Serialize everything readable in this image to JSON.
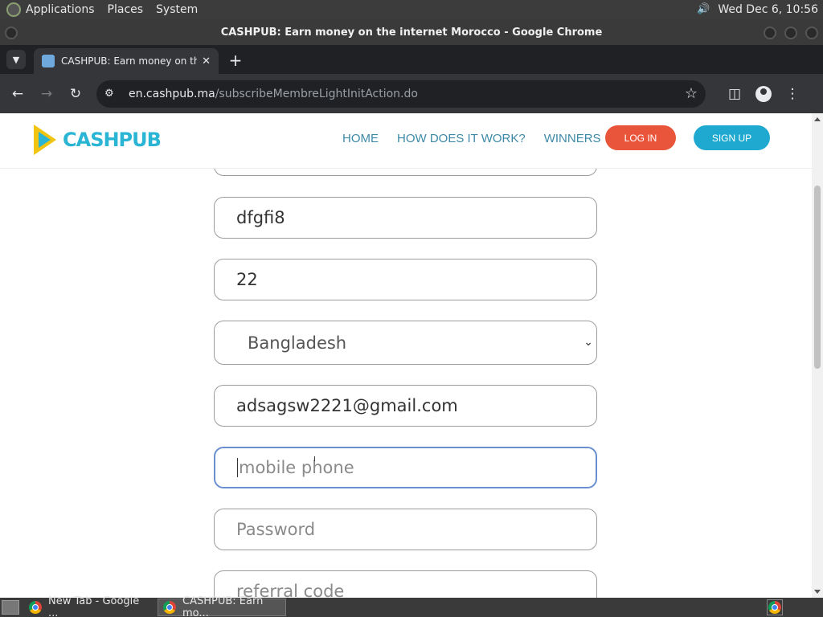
{
  "top_panel": {
    "menus": [
      "Applications",
      "Places",
      "System"
    ],
    "clock": "Wed Dec  6, 10:56"
  },
  "window": {
    "title": "CASHPUB: Earn money on the internet Morocco - Google Chrome"
  },
  "browser": {
    "tab_title": "CASHPUB: Earn money on the internet Morocco",
    "url_host": "en.cashpub.ma",
    "url_path": "/subscribeMembreLightInitAction.do"
  },
  "site": {
    "logo_text": "CASHPUB",
    "nav": [
      "HOME",
      "HOW DOES IT WORK?",
      "WINNERS"
    ],
    "login_label": "LOG IN",
    "signup_label": "SIGN UP"
  },
  "form": {
    "field_name": "dfgfi8",
    "field_age": "22",
    "country_selected": "Bangladesh",
    "email": "adsagsw2221@gmail.com",
    "mobile_placeholder": "mobile phone",
    "password_placeholder": "Password",
    "referral_placeholder": "referral code"
  },
  "taskbar": {
    "tasks": [
      "New Tab - Google ...",
      "CASHPUB: Earn mo..."
    ]
  }
}
